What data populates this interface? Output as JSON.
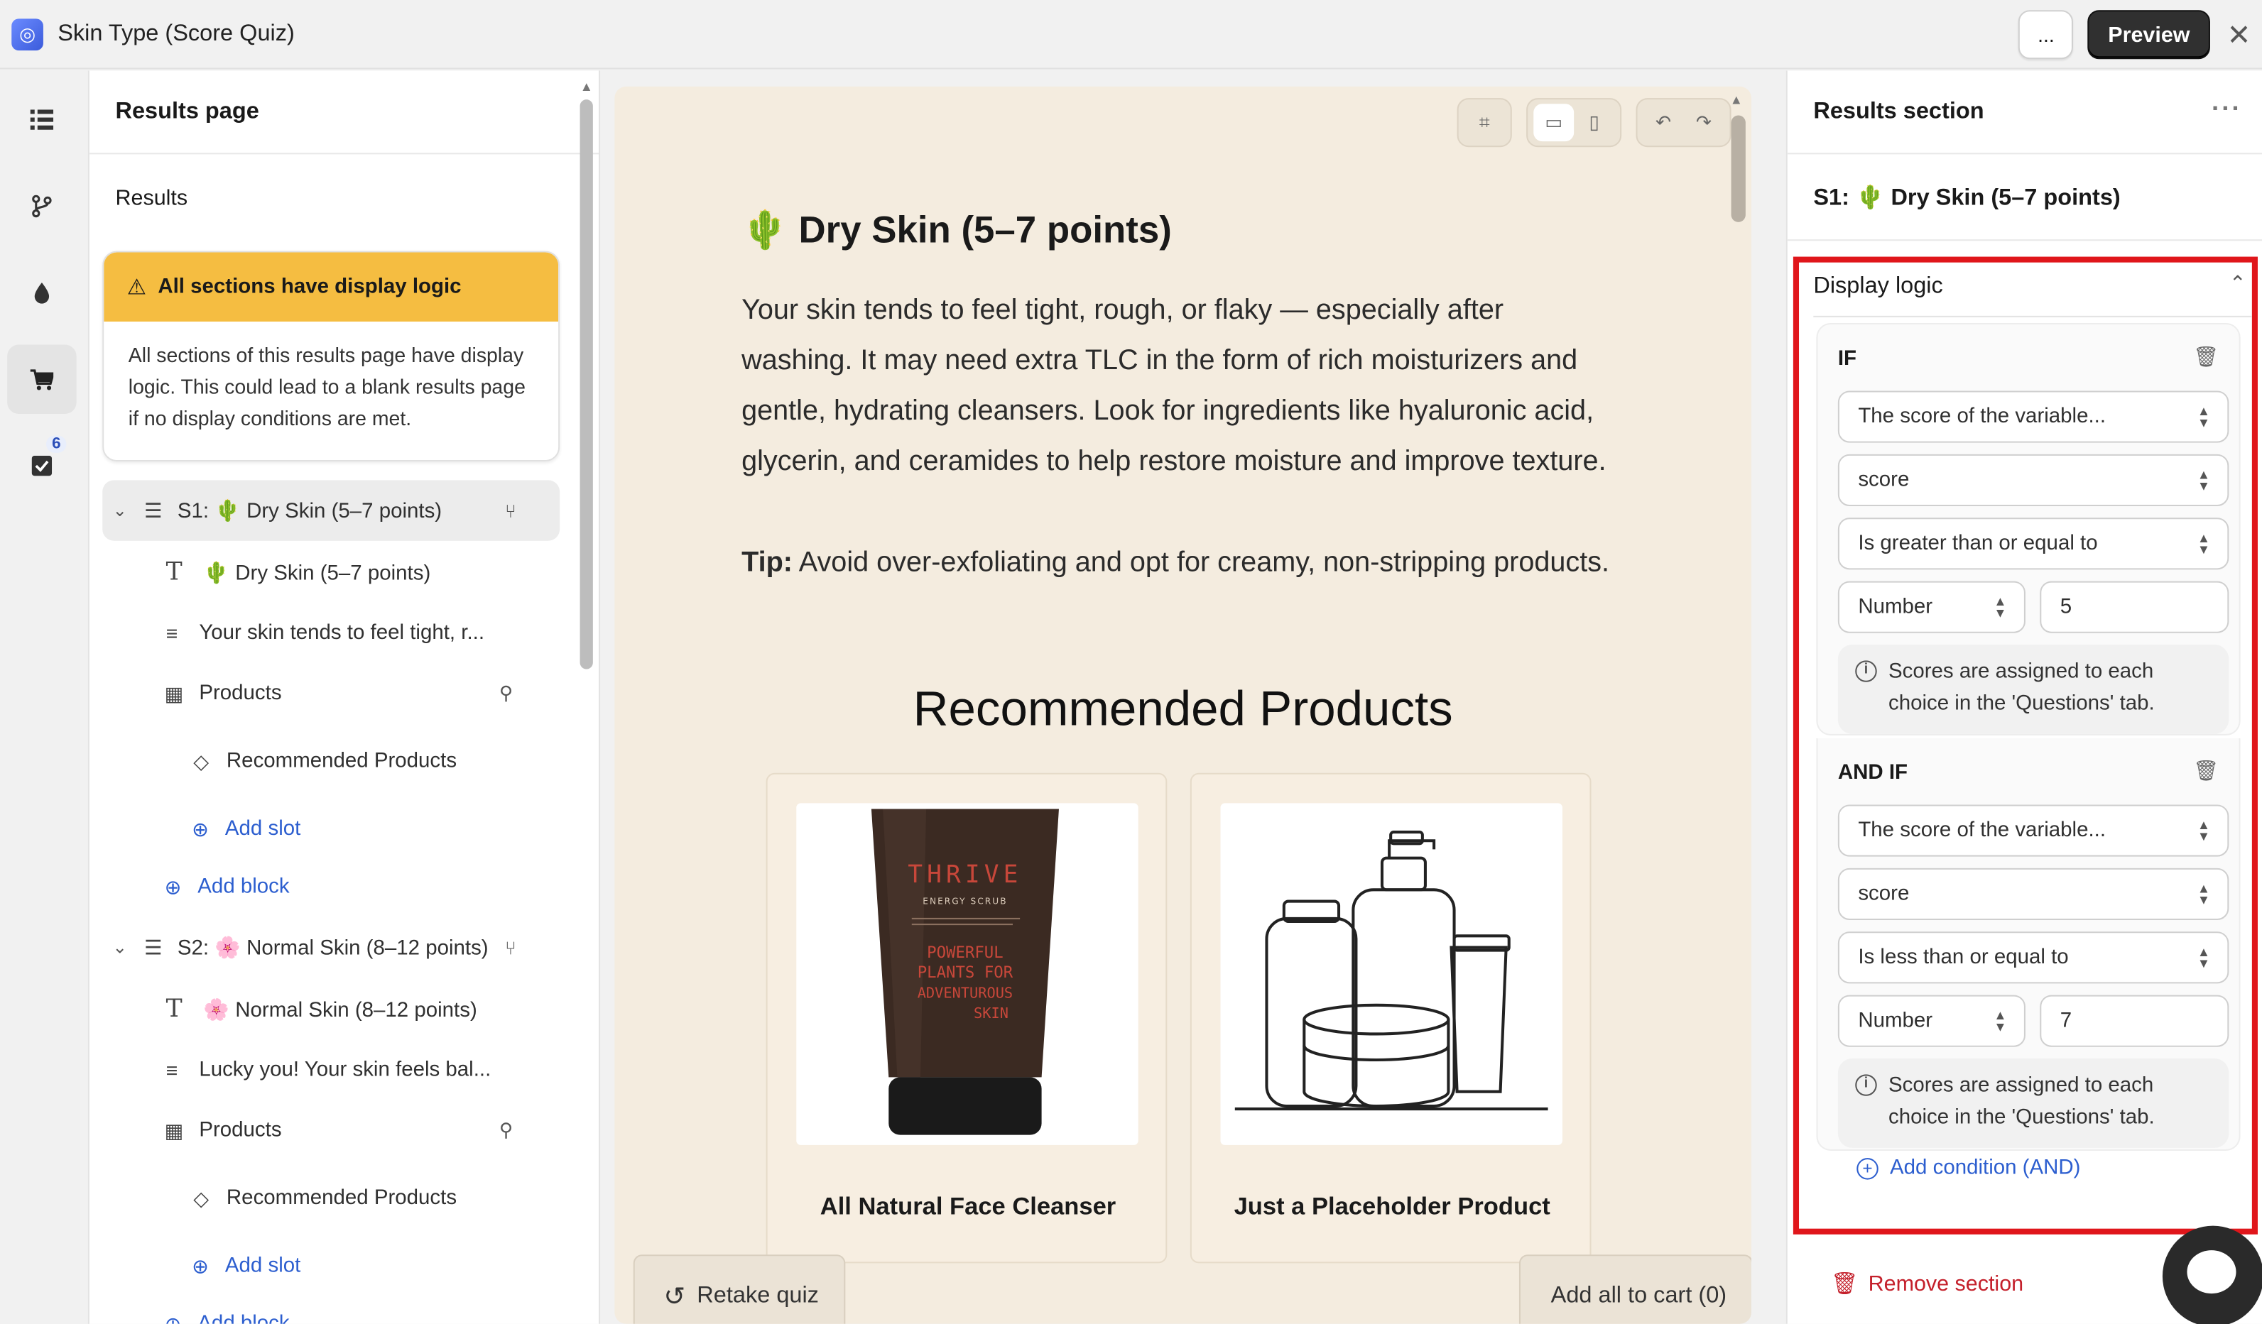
{
  "topbar": {
    "title": "Skin Type (Score Quiz)",
    "more_label": "...",
    "preview_label": "Preview",
    "close_label": "✕"
  },
  "rail": {
    "badge": "6"
  },
  "outline": {
    "title": "Results page",
    "subtitle": "Results",
    "warning": {
      "title": "All sections have display logic",
      "body": "All sections of this results page have display logic. This could lead to a blank results page if no display conditions are met."
    },
    "tree": [
      {
        "label": "S1: 🌵 Dry Skin (5–7 points)"
      },
      {
        "label": "🌵 Dry Skin (5–7 points)"
      },
      {
        "label": "Your skin tends to feel tight, r..."
      },
      {
        "label": "Products"
      },
      {
        "label": "Recommended Products"
      },
      {
        "label": "Add slot"
      },
      {
        "label": "Add block"
      },
      {
        "label": "S2: 🌸 Normal Skin (8–12 points)"
      },
      {
        "label": "🌸 Normal Skin (8–12 points)"
      },
      {
        "label": "Lucky you! Your skin feels bal..."
      },
      {
        "label": "Products"
      },
      {
        "label": "Recommended Products"
      },
      {
        "label": "Add slot"
      },
      {
        "label": "Add block"
      }
    ]
  },
  "canvas": {
    "title": "🌵 Dry Skin (5–7 points)",
    "description": "Your skin tends to feel tight, rough, or flaky — especially after washing. It may need extra TLC in the form of rich moisturizers and gentle, hydrating cleansers. Look for ingredients like hyaluronic acid, glycerin, and ceramides to help restore moisture and improve texture.",
    "tip_label": "Tip:",
    "tip_text": " Avoid over-exfoliating and opt for creamy, non-stripping products.",
    "rec_title": "Recommended Products",
    "products": [
      {
        "name": "All Natural Face Cleanser",
        "tube_text": [
          "THRIVE",
          "ENERGY SCRUB",
          "POWERFUL",
          "PLANTS FOR",
          "ADVENTUROUS",
          "SKIN"
        ]
      },
      {
        "name": "Just a Placeholder Product"
      }
    ],
    "retake_label": "Retake quiz",
    "add_cart_label": "Add all to cart (0)"
  },
  "rpanel": {
    "title": "Results section",
    "section": "S1: 🌵 Dry Skin (5–7 points)",
    "display_logic": "Display logic",
    "conditions": [
      {
        "label": "IF",
        "source": "The score of the variable...",
        "variable": "score",
        "operator": "Is greater than or equal to",
        "type": "Number",
        "value": "5",
        "info": "Scores are assigned to each choice in the 'Questions' tab."
      },
      {
        "label": "AND IF",
        "source": "The score of the variable...",
        "variable": "score",
        "operator": "Is less than or equal to",
        "type": "Number",
        "value": "7",
        "info": "Scores are assigned to each choice in the 'Questions' tab."
      }
    ],
    "add_condition": "Add condition (AND)",
    "remove_section": "Remove section"
  }
}
